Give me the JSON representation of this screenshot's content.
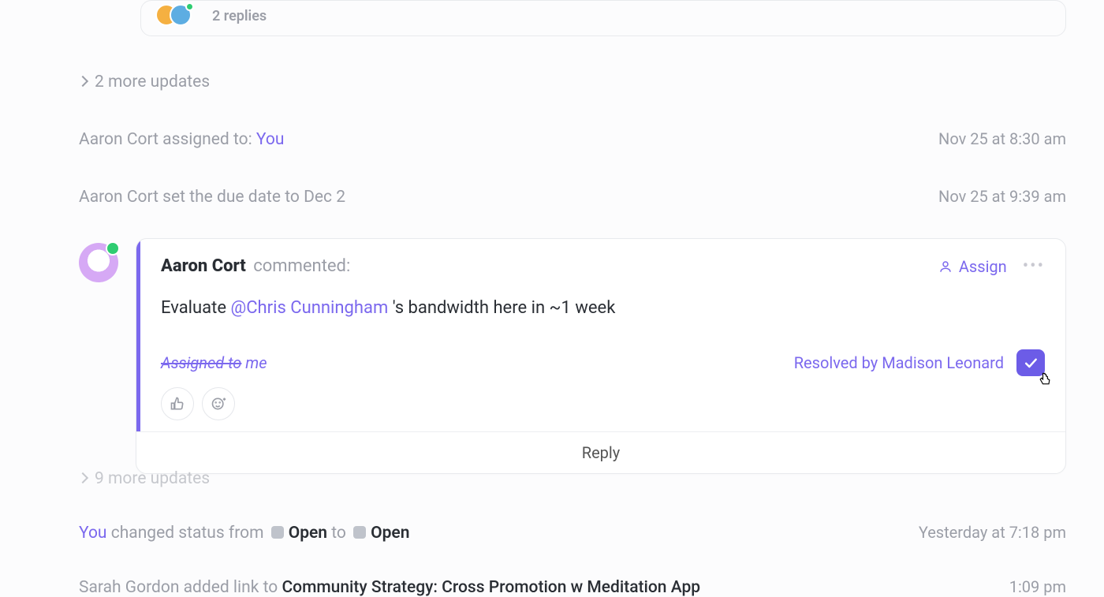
{
  "thread": {
    "replies_label": "2 replies"
  },
  "collapsed1": {
    "label": "2 more updates"
  },
  "activity_assigned": {
    "actor": "Aaron Cort",
    "verb": " assigned to: ",
    "target": "You",
    "timestamp": "Nov 25 at 8:30 am"
  },
  "activity_duedate": {
    "actor": "Aaron Cort",
    "verb": " set the due date to ",
    "value": "Dec 2",
    "timestamp": "Nov 25 at 9:39 am"
  },
  "comment": {
    "author": "Aaron Cort",
    "commented_label": "commented:",
    "assign_label": "Assign",
    "body_pre": "Evaluate ",
    "mention": "@Chris Cunningham",
    "body_post": " 's bandwidth here in ~1 week",
    "assigned_label_strike": "Assigned to",
    "assigned_label_rest": " me",
    "resolved_label": "Resolved by Madison Leonard",
    "reply_label": "Reply"
  },
  "collapsed2": {
    "label": "9 more updates"
  },
  "activity_status": {
    "actor": "You",
    "verb": " changed status from ",
    "from": "Open",
    "to_word": " to ",
    "to": "Open",
    "timestamp": "Yesterday at 7:18 pm"
  },
  "activity_link": {
    "actor": "Sarah Gordon",
    "verb": " added link to ",
    "link": "Community Strategy: Cross Promotion w Meditation App",
    "timestamp": "1:09 pm"
  }
}
